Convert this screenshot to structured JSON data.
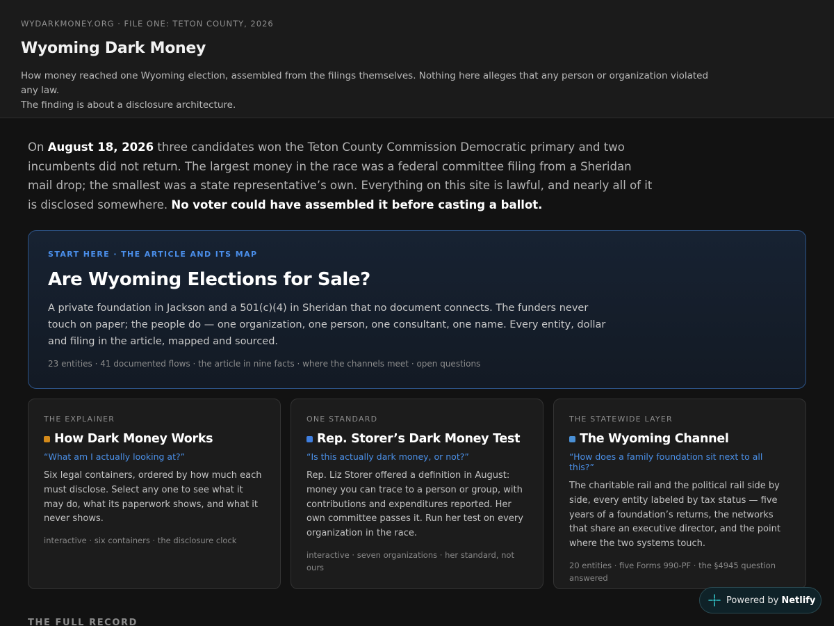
{
  "header": {
    "kicker": "WYDARKMONEY.ORG · FILE ONE: TETON COUNTY, 2026",
    "title": "Wyoming Dark Money",
    "description_line1": "How money reached one Wyoming election, assembled from the filings themselves. Nothing here alleges that any person or organization violated any law.",
    "description_line2": "The finding is about a disclosure architecture."
  },
  "lede": {
    "part1": "On ",
    "date": "August 18, 2026",
    "part2": " three candidates won the Teton County Commission Democratic primary and two incumbents did not return. The largest money in the race was a federal committee filing from a Sheridan mail drop; the smallest was a state representative’s own. Everything on this site is lawful, and nearly all of it is disclosed somewhere. ",
    "emphasis": "No voter could have assembled it before casting a ballot."
  },
  "feature": {
    "kicker": "START HERE · THE ARTICLE AND ITS MAP",
    "title": "Are Wyoming Elections for Sale?",
    "body": "A private foundation in Jackson and a 501(c)(4) in Sheridan that no document connects. The funders never touch on paper; the people do — one organization, one person, one consultant, one name. Every entity, dollar and filing in the article, mapped and sourced.",
    "meta": "23 entities · 41 documented flows · the article in nine facts · where the channels meet · open questions",
    "border_color": "#2d5488",
    "accent_color": "#4a8eea"
  },
  "cards": [
    {
      "kicker": "THE EXPLAINER",
      "title": "How Dark Money Works",
      "dot_color": "#d48a1a",
      "question": "“What am I actually looking at?”",
      "body": "Six legal containers, ordered by how much each must disclose. Select any one to see what it may do, what its paperwork shows, and what it never shows.",
      "meta": "interactive · six containers · the disclosure clock"
    },
    {
      "kicker": "ONE STANDARD",
      "title": "Rep. Storer’s Dark Money Test",
      "dot_color": "#3f7fe0",
      "question": "“Is this actually dark money, or not?”",
      "body": "Rep. Liz Storer offered a definition in August: money you can trace to a person or group, with contributions and expenditures reported. Her own committee passes it. Run her test on every organization in the race.",
      "meta": "interactive · seven organizations · her standard, not ours"
    },
    {
      "kicker": "THE STATEWIDE LAYER",
      "title": "The Wyoming Channel",
      "dot_color": "#4a90d6",
      "question": "“How does a family foundation sit next to all this?”",
      "body": "The charitable rail and the political rail side by side, every entity labeled by tax status — five years of a foundation’s returns, the networks that share an executive director, and the point where the two systems touch.",
      "meta": "20 entities · five Forms 990-PF · the §4945 question answered"
    }
  ],
  "section": {
    "label": "THE FULL RECORD"
  },
  "badge": {
    "prefix": "Powered by",
    "brand": "Netlify",
    "icon": "netlify-icon",
    "icon_color": "#32c3c7"
  }
}
